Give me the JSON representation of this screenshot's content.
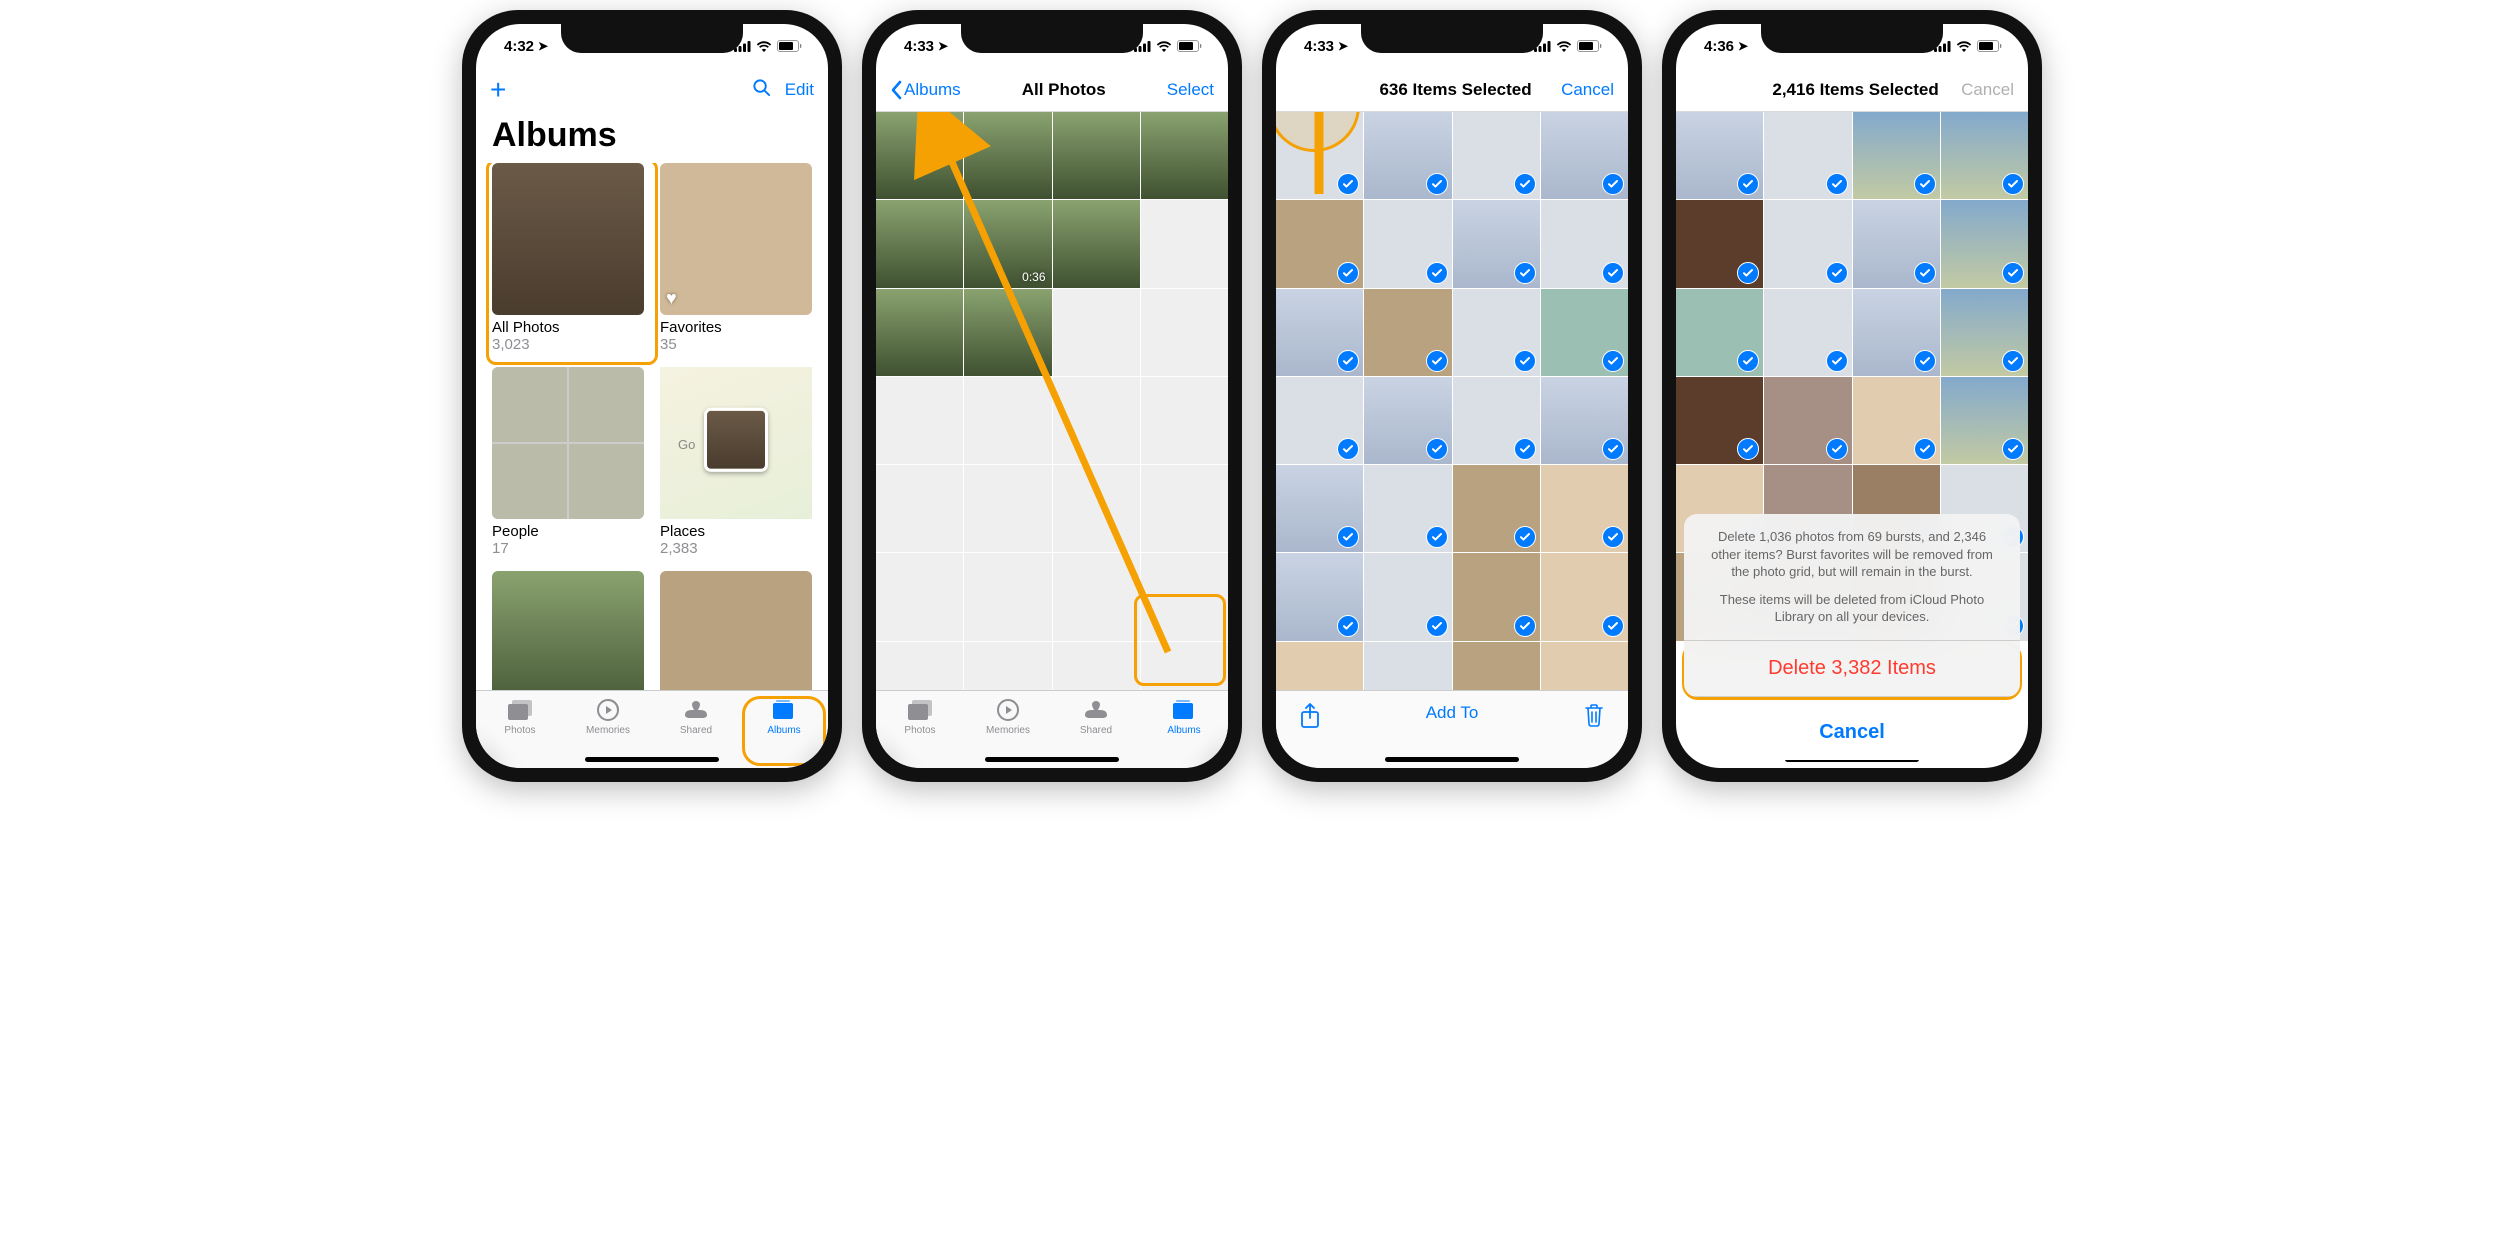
{
  "screen1": {
    "status_time": "4:32",
    "nav": {
      "add": "+",
      "search": "search",
      "edit": "Edit"
    },
    "title": "Albums",
    "albums": [
      {
        "label": "All Photos",
        "count": "3,023"
      },
      {
        "label": "Favorites",
        "count": "35"
      },
      {
        "label": "People",
        "count": "17"
      },
      {
        "label": "Places",
        "count": "2,383"
      }
    ],
    "tabs": [
      {
        "label": "Photos"
      },
      {
        "label": "Memories"
      },
      {
        "label": "Shared"
      },
      {
        "label": "Albums"
      }
    ]
  },
  "screen2": {
    "status_time": "4:33",
    "nav": {
      "back": "Albums",
      "title": "All Photos",
      "select": "Select"
    },
    "video_duration": "0:36",
    "tabs": [
      {
        "label": "Photos"
      },
      {
        "label": "Memories"
      },
      {
        "label": "Shared"
      },
      {
        "label": "Albums"
      }
    ]
  },
  "screen3": {
    "status_time": "4:33",
    "nav": {
      "title": "636 Items Selected",
      "cancel": "Cancel"
    },
    "toolbar": {
      "add_to": "Add To"
    }
  },
  "screen4": {
    "status_time": "4:36",
    "nav": {
      "title": "2,416 Items Selected",
      "cancel": "Cancel"
    },
    "sheet": {
      "message_1": "Delete 1,036 photos from 69 bursts, and 2,346 other items? Burst favorites will be removed from the photo grid, but will remain in the burst.",
      "message_2": "These items will be deleted from iCloud Photo Library on all your devices.",
      "delete": "Delete 3,382 Items",
      "cancel": "Cancel"
    }
  },
  "places_label": "Go"
}
